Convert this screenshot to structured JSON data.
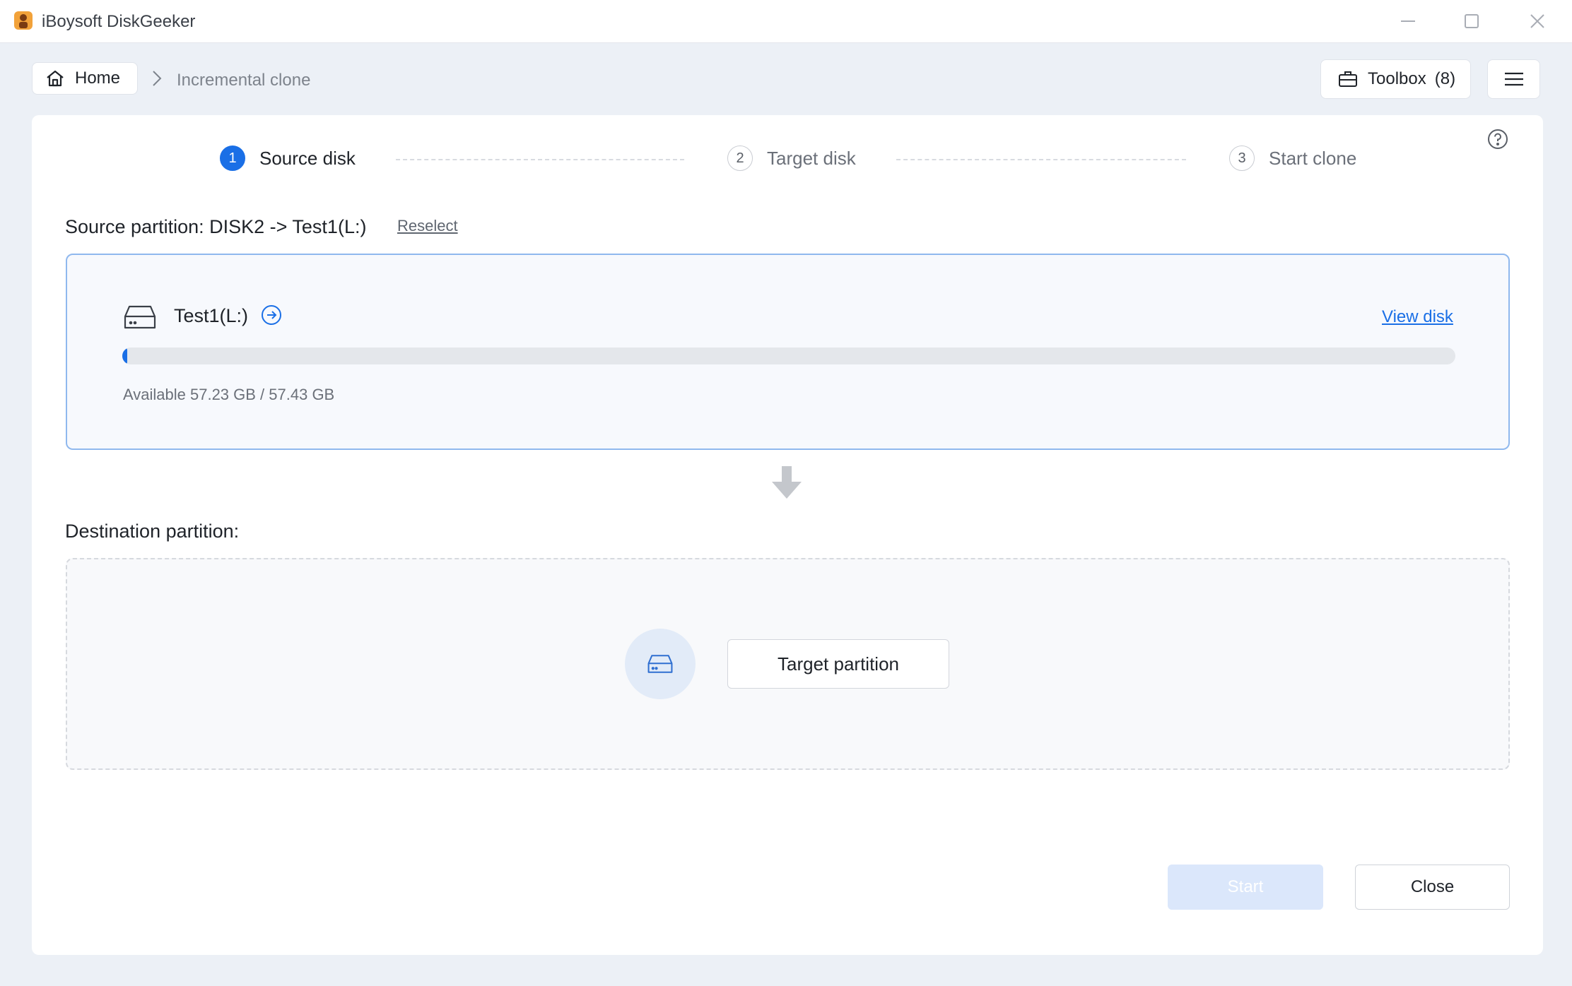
{
  "window": {
    "title": "iBoysoft DiskGeeker",
    "controls": [
      "minimize-icon",
      "maximize-icon",
      "close-icon"
    ]
  },
  "nav": {
    "home_label": "Home",
    "breadcrumb_current": "Incremental clone",
    "toolbox_label": "Toolbox",
    "toolbox_count": "(8)"
  },
  "steps": [
    {
      "number": "1",
      "label": "Source disk",
      "active": true
    },
    {
      "number": "2",
      "label": "Target disk",
      "active": false
    },
    {
      "number": "3",
      "label": "Start clone",
      "active": false
    }
  ],
  "source": {
    "label": "Source partition: DISK2 -> Test1(L:)",
    "reselect_label": "Reselect",
    "partition_name": "Test1(L:)",
    "view_disk_label": "View disk",
    "available_text": "Available 57.23 GB / 57.43 GB",
    "used_fraction": 0.0035
  },
  "destination": {
    "label": "Destination partition:",
    "target_button_label": "Target partition"
  },
  "footer": {
    "start_label": "Start",
    "close_label": "Close"
  },
  "colors": {
    "accent": "#1a6fe6",
    "background": "#ecf0f6",
    "start_disabled": "#dbe7fb"
  }
}
